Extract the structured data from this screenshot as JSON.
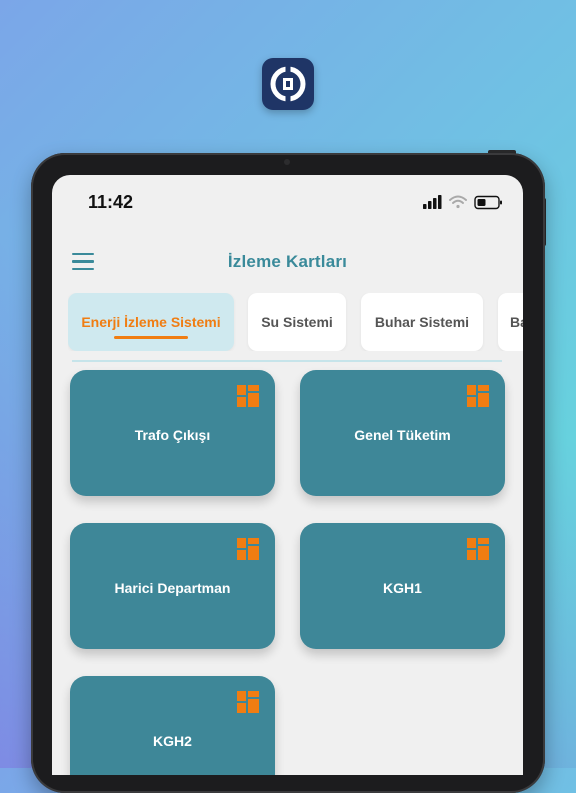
{
  "status_bar": {
    "time": "11:42"
  },
  "header": {
    "title": "İzleme Kartları"
  },
  "tabs": [
    {
      "label": "Enerji İzleme Sistemi",
      "active": true
    },
    {
      "label": "Su Sistemi",
      "active": false
    },
    {
      "label": "Buhar Sistemi",
      "active": false
    },
    {
      "label": "Ba",
      "active": false
    }
  ],
  "cards": [
    {
      "label": "Trafo Çıkışı"
    },
    {
      "label": "Genel Tüketim"
    },
    {
      "label": "Harici Departman"
    },
    {
      "label": "KGH1"
    },
    {
      "label": "KGH2"
    }
  ],
  "colors": {
    "accent": "#3a8a9a",
    "card": "#3e8798",
    "active_tab_bg": "#cfe9ef",
    "active_tab_text": "#f07d12",
    "icon_orange": "#f07d12",
    "app_icon_bg": "#1f3566"
  },
  "icons": {
    "app": "app-logo-icon",
    "menu": "hamburger-menu-icon",
    "card": "grid-squares-icon",
    "signal": "cellular-signal-icon",
    "wifi": "wifi-icon",
    "battery": "battery-icon"
  }
}
